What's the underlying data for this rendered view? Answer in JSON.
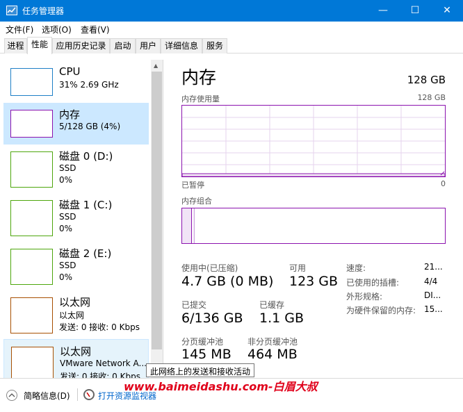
{
  "window": {
    "title": "任务管理器",
    "minimize": "—",
    "maximize": "☐",
    "close": "✕"
  },
  "menu": [
    "文件(F)",
    "选项(O)",
    "查看(V)"
  ],
  "tabs": [
    "进程",
    "性能",
    "应用历史记录",
    "启动",
    "用户",
    "详细信息",
    "服务"
  ],
  "active_tab": "性能",
  "resources": [
    {
      "name": "CPU",
      "line2": "31% 2.69 GHz",
      "line3": "",
      "color": "#1e7fc6",
      "selected": false
    },
    {
      "name": "内存",
      "line2": "5/128 GB (4%)",
      "line3": "",
      "color": "#8b12ae",
      "selected": true
    },
    {
      "name": "磁盘 0 (D:)",
      "line2": "SSD",
      "line3": "0%",
      "color": "#4da60c",
      "selected": false
    },
    {
      "name": "磁盘 1 (C:)",
      "line2": "SSD",
      "line3": "0%",
      "color": "#4da60c",
      "selected": false
    },
    {
      "name": "磁盘 2 (E:)",
      "line2": "SSD",
      "line3": "0%",
      "color": "#4da60c",
      "selected": false
    },
    {
      "name": "以太网",
      "line2": "以太网",
      "line3": "发送: 0 接收: 0 Kbps",
      "color": "#a74f01",
      "selected": false
    },
    {
      "name": "以太网",
      "line2": "VMware Network A...",
      "line3": "发送: 0 接收: 0 Kbps",
      "color": "#a74f01",
      "selected": false
    }
  ],
  "detail": {
    "title": "内存",
    "total": "128 GB",
    "usage_graph_label": "内存使用量",
    "usage_graph_max": "128 GB",
    "graph_left_caption": "已暂停",
    "graph_right_caption": "0",
    "composition_label": "内存组合",
    "in_use_label": "使用中(已压缩)",
    "in_use_value": "4.7 GB (0 MB)",
    "available_label": "可用",
    "available_value": "123 GB",
    "committed_label": "已提交",
    "committed_value": "6/136 GB",
    "cached_label": "已缓存",
    "cached_value": "1.1 GB",
    "paged_pool_label": "分页缓冲池",
    "paged_pool_value": "145 MB",
    "nonpaged_pool_label": "非分页缓冲池",
    "nonpaged_pool_value": "464 MB",
    "specs": [
      {
        "label": "速度:",
        "value": "21..."
      },
      {
        "label": "已使用的插槽:",
        "value": "4/4"
      },
      {
        "label": "外形规格:",
        "value": "DI..."
      },
      {
        "label": "为硬件保留的内存:",
        "value": "15..."
      }
    ],
    "accent": "#8b12ae"
  },
  "bottom": {
    "fewer_details": "简略信息(D)",
    "open_monitor": "打开资源监视器"
  },
  "tooltip": "此网络上的发送和接收活动",
  "watermark": "www.baimeidashu.com-白眉大叔"
}
